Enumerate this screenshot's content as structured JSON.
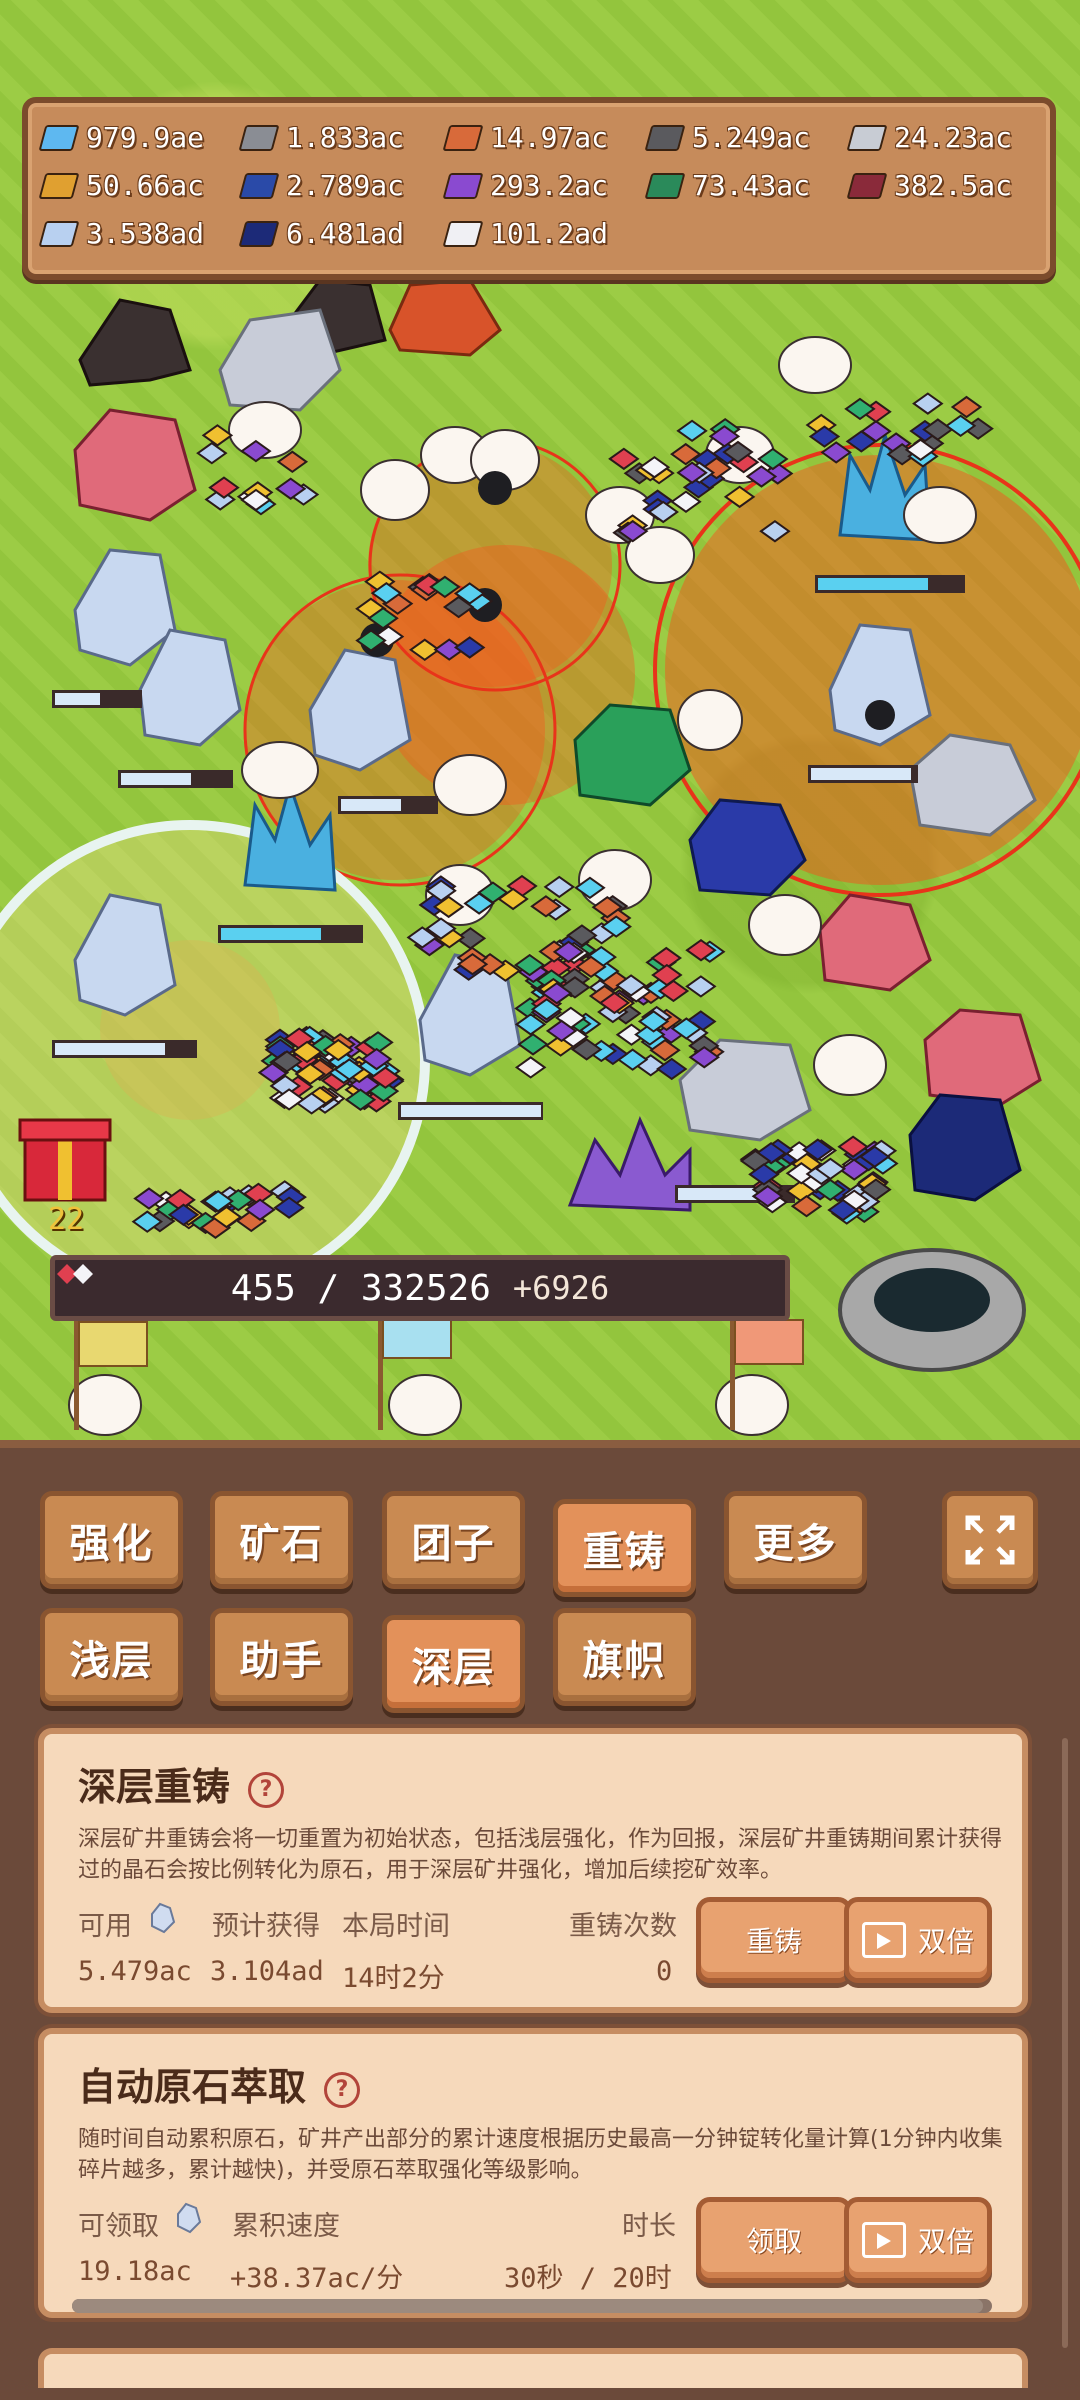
{
  "resources": [
    {
      "value": "979.9ae",
      "color": "#5eb8f0",
      "icon": "diamond-icon"
    },
    {
      "value": "1.833ac",
      "color": "#8a8d94",
      "icon": "iron-bar-icon"
    },
    {
      "value": "14.97ac",
      "color": "#d86a3a",
      "icon": "copper-bar-icon"
    },
    {
      "value": "5.249ac",
      "color": "#5a5a5e",
      "icon": "coal-bar-icon"
    },
    {
      "value": "24.23ac",
      "color": "#c8ccd4",
      "icon": "silver-bar-icon"
    },
    {
      "value": "50.66ac",
      "color": "#e0a030",
      "icon": "gold-bar-icon"
    },
    {
      "value": "2.789ac",
      "color": "#2a4aa8",
      "icon": "sapphire-bar-icon"
    },
    {
      "value": "293.2ac",
      "color": "#8a4ad0",
      "icon": "amethyst-bar-icon"
    },
    {
      "value": "73.43ac",
      "color": "#2a8a5a",
      "icon": "emerald-bar-icon"
    },
    {
      "value": "382.5ac",
      "color": "#8a2a3a",
      "icon": "ruby-bar-icon"
    },
    {
      "value": "3.538ad",
      "color": "#b8d0f0",
      "icon": "crystal-bar-icon"
    },
    {
      "value": "6.481ad",
      "color": "#1c2a78",
      "icon": "lapis-bar-icon"
    },
    {
      "value": "101.2ad",
      "color": "#f0f0f4",
      "icon": "white-bar-icon"
    }
  ],
  "counter": {
    "text": "455 / 332526",
    "delta": "+6926"
  },
  "gift": {
    "count": "22"
  },
  "tabs_row1": [
    {
      "label": "强化",
      "active": false
    },
    {
      "label": "矿石",
      "active": false
    },
    {
      "label": "团子",
      "active": false
    },
    {
      "label": "重铸",
      "active": true
    },
    {
      "label": "更多",
      "active": false
    }
  ],
  "tabs_row2": [
    {
      "label": "浅层",
      "active": false
    },
    {
      "label": "助手",
      "active": false
    },
    {
      "label": "深层",
      "active": true
    },
    {
      "label": "旗帜",
      "active": false
    }
  ],
  "deep_reforge": {
    "title": "深层重铸",
    "help": "?",
    "desc": "深层矿井重铸会将一切重置为初始状态，包括浅层强化，作为回报，深层矿井重铸期间累计获得过的晶石会按比例转化为原石，用于深层矿井强化，增加后续挖矿效率。",
    "available_label": "可用",
    "expected_label": "预计获得",
    "time_label": "本局时间",
    "count_label": "重铸次数",
    "available_value": "5.479ac",
    "expected_value": "3.104ad",
    "time_value": "14时2分",
    "count_value": "0",
    "reforge_btn": "重铸",
    "double_btn": "双倍"
  },
  "auto_extract": {
    "title": "自动原石萃取",
    "help": "?",
    "desc": "随时间自动累积原石，矿井产出部分的累计速度根据历史最高一分钟锭转化量计算(1分钟内收集碎片越多，累计越快)，并受原石萃取强化等级影响。",
    "claimable_label": "可领取",
    "rate_label": "累积速度",
    "duration_label": "时长",
    "claimable_value": "19.18ac",
    "rate_value": "+38.37ac/分",
    "duration_value": "30秒 / 20时",
    "progress": 0.99,
    "claim_btn": "领取",
    "double_btn": "双倍"
  }
}
